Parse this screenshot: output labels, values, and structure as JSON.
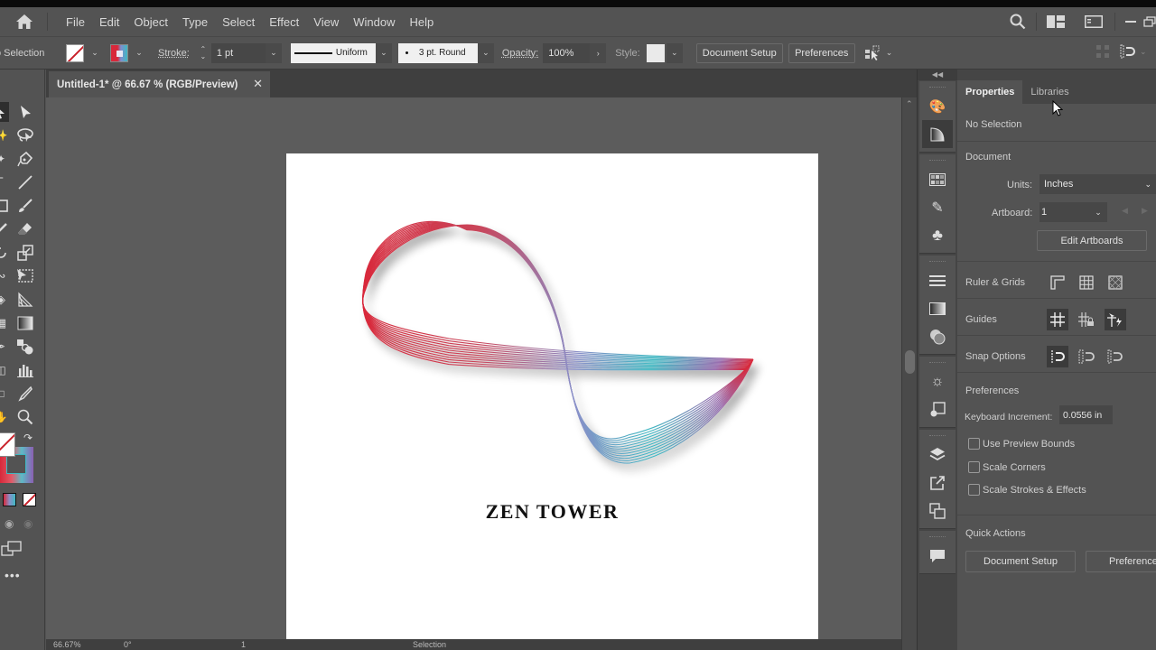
{
  "menubar": {
    "items": [
      "File",
      "Edit",
      "Object",
      "Type",
      "Select",
      "Effect",
      "View",
      "Window",
      "Help"
    ]
  },
  "controlbar": {
    "selection_label": "No Selection",
    "stroke_label": "Stroke:",
    "stroke_value": "1 pt",
    "profile_value": "Uniform",
    "brush_value": "3 pt. Round",
    "opacity_label": "Opacity:",
    "opacity_value": "100%",
    "style_label": "Style:",
    "document_setup_label": "Document Setup",
    "preferences_label": "Preferences"
  },
  "document": {
    "tab_title": "Untitled-1* @ 66.67 % (RGB/Preview)",
    "artwork_text": "ZEN TOWER",
    "gradient_colors": [
      "#d8283a",
      "#8a8fc8",
      "#3fb8c2"
    ]
  },
  "statusbar": {
    "zoom": "66.67%",
    "rotation": "0°",
    "artboard": "1",
    "tool": "Selection"
  },
  "properties": {
    "tabs": [
      {
        "label": "Properties",
        "active": true
      },
      {
        "label": "Libraries",
        "active": false
      }
    ],
    "no_selection": "No Selection",
    "document_heading": "Document",
    "units_label": "Units:",
    "units_value": "Inches",
    "artboard_label": "Artboard:",
    "artboard_value": "1",
    "edit_artboards_label": "Edit Artboards",
    "ruler_grids_label": "Ruler & Grids",
    "guides_label": "Guides",
    "snap_options_label": "Snap Options",
    "preferences_heading": "Preferences",
    "keyboard_increment_label": "Keyboard Increment:",
    "keyboard_increment_value": "0.0556 in",
    "checkboxes": [
      {
        "label": "Use Preview Bounds",
        "checked": false
      },
      {
        "label": "Scale Corners",
        "checked": false
      },
      {
        "label": "Scale Strokes & Effects",
        "checked": false
      }
    ],
    "quick_actions_heading": "Quick Actions",
    "quick_document_setup_label": "Document Setup",
    "quick_preferences_label": "Preferences"
  }
}
